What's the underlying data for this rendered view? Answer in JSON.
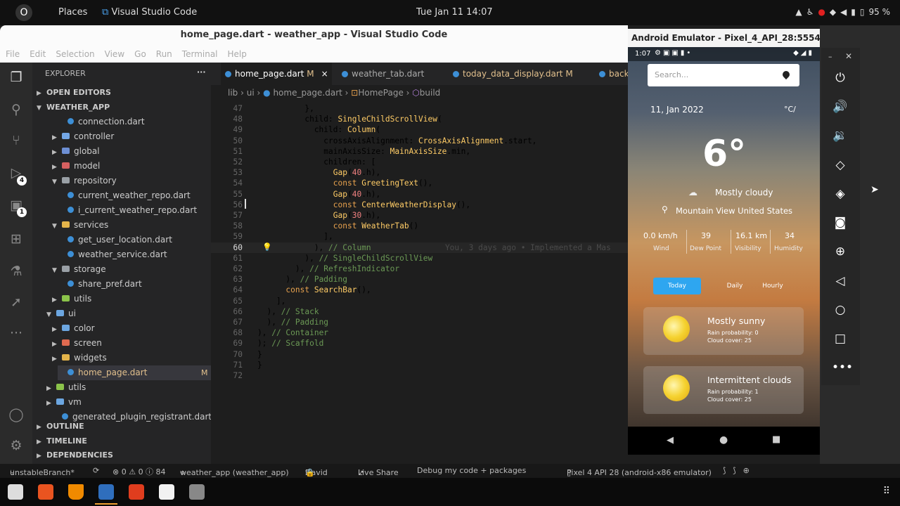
{
  "topbar": {
    "activities": "O",
    "places": "Places",
    "app": "Visual Studio Code",
    "clock": "Tue Jan 11  14:07",
    "battery": "95 %"
  },
  "window": {
    "title": "home_page.dart - weather_app - Visual Studio Code"
  },
  "menu": [
    "File",
    "Edit",
    "Selection",
    "View",
    "Go",
    "Run",
    "Terminal",
    "Help"
  ],
  "activity_badges": [
    "4",
    "1"
  ],
  "explorer": {
    "header": "EXPLORER",
    "more": "···",
    "open_editors": "OPEN EDITORS",
    "project": "WEATHER_APP",
    "tree": [
      {
        "label": "connection.dart",
        "kind": "file"
      },
      {
        "label": "controller",
        "kind": "folder"
      },
      {
        "label": "global",
        "kind": "folder"
      },
      {
        "label": "model",
        "kind": "folder"
      },
      {
        "label": "repository",
        "kind": "folder-open"
      },
      {
        "label": "current_weather_repo.dart",
        "kind": "file"
      },
      {
        "label": "i_current_weather_repo.dart",
        "kind": "file"
      },
      {
        "label": "services",
        "kind": "folder-open"
      },
      {
        "label": "get_user_location.dart",
        "kind": "file"
      },
      {
        "label": "weather_service.dart",
        "kind": "file"
      },
      {
        "label": "storage",
        "kind": "folder-open"
      },
      {
        "label": "share_pref.dart",
        "kind": "file"
      },
      {
        "label": "utils",
        "kind": "folder"
      },
      {
        "label": "ui",
        "kind": "folder-open"
      },
      {
        "label": "color",
        "kind": "folder"
      },
      {
        "label": "screen",
        "kind": "folder"
      },
      {
        "label": "widgets",
        "kind": "folder"
      },
      {
        "label": "home_page.dart",
        "kind": "file",
        "badge": "M"
      },
      {
        "label": "utils",
        "kind": "folder"
      },
      {
        "label": "vm",
        "kind": "folder"
      },
      {
        "label": "generated_plugin_registrant.dart",
        "kind": "file"
      }
    ],
    "outline": "OUTLINE",
    "timeline": "TIMELINE",
    "dependencies": "DEPENDENCIES"
  },
  "tabs": [
    {
      "label": "home_page.dart",
      "badge": "M",
      "close": "×"
    },
    {
      "label": "weather_tab.dart"
    },
    {
      "label": "today_data_display.dart",
      "badge": "M"
    },
    {
      "label": "back"
    }
  ],
  "breadcrumb": {
    "a": "lib",
    "b": "ui",
    "c": "home_page.dart",
    "d": "HomePage",
    "e": "build"
  },
  "code": [
    {
      "n": "47",
      "t": "          },"
    },
    {
      "n": "48",
      "t": "          child: SingleChildScrollView("
    },
    {
      "n": "49",
      "t": "            child: Column("
    },
    {
      "n": "50",
      "t": "              crossAxisAlignment: CrossAxisAlignment.start,"
    },
    {
      "n": "51",
      "t": "              mainAxisSize: MainAxisSize.min,"
    },
    {
      "n": "52",
      "t": "              children: ["
    },
    {
      "n": "53",
      "t": "                Gap(40.h),"
    },
    {
      "n": "54",
      "t": "                const GreetingText(),"
    },
    {
      "n": "55",
      "t": "                Gap(40.h),"
    },
    {
      "n": "56",
      "t": "                const CenterWeatherDisplay(),"
    },
    {
      "n": "57",
      "t": "                Gap(30.h),"
    },
    {
      "n": "58",
      "t": "                const WeatherTab()"
    },
    {
      "n": "59",
      "t": "              ],"
    },
    {
      "n": "60",
      "t": "            ), // Column",
      "blame": "    You, 3 days ago • Implemented a Mas"
    },
    {
      "n": "61",
      "t": "          ), // SingleChildScrollView"
    },
    {
      "n": "62",
      "t": "        ), // RefreshIndicator"
    },
    {
      "n": "63",
      "t": "      ), // Padding"
    },
    {
      "n": "64",
      "t": "      const SearchBar(),"
    },
    {
      "n": "65",
      "t": "    ],"
    },
    {
      "n": "66",
      "t": "  ), // Stack"
    },
    {
      "n": "67",
      "t": "  ), // Padding"
    },
    {
      "n": "68",
      "t": "), // Container"
    },
    {
      "n": "69",
      "t": "); // Scaffold"
    },
    {
      "n": "70",
      "t": "}"
    },
    {
      "n": "71",
      "t": "}"
    },
    {
      "n": "72",
      "t": ""
    }
  ],
  "status": {
    "branch": "unstableBranch*",
    "problems": "⊗ 0 ⚠ 0 ⓘ 84",
    "project": "weather_app (weather_app)",
    "user": "David",
    "live": "Live Share",
    "debug": "Debug my code + packages",
    "device": "Pixel 4 API 28 (android-x86 emulator)"
  },
  "emulator": {
    "title": "Android Emulator - Pixel_4_API_28:5554",
    "time": "1:07",
    "search_placeholder": "Search...",
    "date": "11, Jan 2022",
    "unit": "°C/",
    "temp": "6°",
    "condition": "Mostly cloudy",
    "location": "Mountain View  United States",
    "stats": [
      {
        "value": "0.0 km/h",
        "label": "Wind"
      },
      {
        "value": "39",
        "label": "Dew Point"
      },
      {
        "value": "16.1 km",
        "label": "Visibility"
      },
      {
        "value": "34",
        "label": "Humidity"
      }
    ],
    "tabs": [
      "Today",
      "Daily",
      "Hourly"
    ],
    "cards": [
      {
        "title": "Mostly sunny",
        "rain": "Rain probability:  0",
        "cloud": "Cloud cover:  25"
      },
      {
        "title": "Intermittent clouds",
        "rain": "Rain probability:  1",
        "cloud": "Cloud cover:  25"
      }
    ]
  }
}
